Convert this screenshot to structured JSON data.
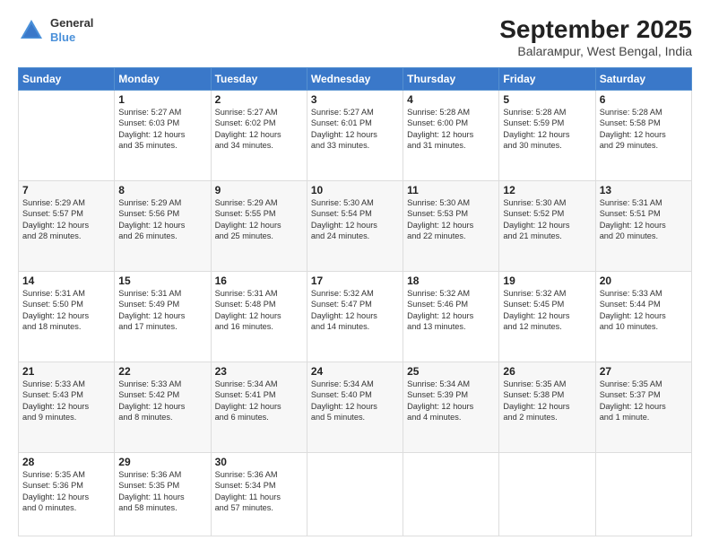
{
  "header": {
    "logo": {
      "line1": "General",
      "line2": "Blue"
    },
    "title": "September 2025",
    "subtitle": "Balarамpur, West Bengal, India"
  },
  "days_header": [
    "Sunday",
    "Monday",
    "Tuesday",
    "Wednesday",
    "Thursday",
    "Friday",
    "Saturday"
  ],
  "weeks": [
    [
      {
        "num": "",
        "lines": []
      },
      {
        "num": "1",
        "lines": [
          "Sunrise: 5:27 AM",
          "Sunset: 6:03 PM",
          "Daylight: 12 hours",
          "and 35 minutes."
        ]
      },
      {
        "num": "2",
        "lines": [
          "Sunrise: 5:27 AM",
          "Sunset: 6:02 PM",
          "Daylight: 12 hours",
          "and 34 minutes."
        ]
      },
      {
        "num": "3",
        "lines": [
          "Sunrise: 5:27 AM",
          "Sunset: 6:01 PM",
          "Daylight: 12 hours",
          "and 33 minutes."
        ]
      },
      {
        "num": "4",
        "lines": [
          "Sunrise: 5:28 AM",
          "Sunset: 6:00 PM",
          "Daylight: 12 hours",
          "and 31 minutes."
        ]
      },
      {
        "num": "5",
        "lines": [
          "Sunrise: 5:28 AM",
          "Sunset: 5:59 PM",
          "Daylight: 12 hours",
          "and 30 minutes."
        ]
      },
      {
        "num": "6",
        "lines": [
          "Sunrise: 5:28 AM",
          "Sunset: 5:58 PM",
          "Daylight: 12 hours",
          "and 29 minutes."
        ]
      }
    ],
    [
      {
        "num": "7",
        "lines": [
          "Sunrise: 5:29 AM",
          "Sunset: 5:57 PM",
          "Daylight: 12 hours",
          "and 28 minutes."
        ]
      },
      {
        "num": "8",
        "lines": [
          "Sunrise: 5:29 AM",
          "Sunset: 5:56 PM",
          "Daylight: 12 hours",
          "and 26 minutes."
        ]
      },
      {
        "num": "9",
        "lines": [
          "Sunrise: 5:29 AM",
          "Sunset: 5:55 PM",
          "Daylight: 12 hours",
          "and 25 minutes."
        ]
      },
      {
        "num": "10",
        "lines": [
          "Sunrise: 5:30 AM",
          "Sunset: 5:54 PM",
          "Daylight: 12 hours",
          "and 24 minutes."
        ]
      },
      {
        "num": "11",
        "lines": [
          "Sunrise: 5:30 AM",
          "Sunset: 5:53 PM",
          "Daylight: 12 hours",
          "and 22 minutes."
        ]
      },
      {
        "num": "12",
        "lines": [
          "Sunrise: 5:30 AM",
          "Sunset: 5:52 PM",
          "Daylight: 12 hours",
          "and 21 minutes."
        ]
      },
      {
        "num": "13",
        "lines": [
          "Sunrise: 5:31 AM",
          "Sunset: 5:51 PM",
          "Daylight: 12 hours",
          "and 20 minutes."
        ]
      }
    ],
    [
      {
        "num": "14",
        "lines": [
          "Sunrise: 5:31 AM",
          "Sunset: 5:50 PM",
          "Daylight: 12 hours",
          "and 18 minutes."
        ]
      },
      {
        "num": "15",
        "lines": [
          "Sunrise: 5:31 AM",
          "Sunset: 5:49 PM",
          "Daylight: 12 hours",
          "and 17 minutes."
        ]
      },
      {
        "num": "16",
        "lines": [
          "Sunrise: 5:31 AM",
          "Sunset: 5:48 PM",
          "Daylight: 12 hours",
          "and 16 minutes."
        ]
      },
      {
        "num": "17",
        "lines": [
          "Sunrise: 5:32 AM",
          "Sunset: 5:47 PM",
          "Daylight: 12 hours",
          "and 14 minutes."
        ]
      },
      {
        "num": "18",
        "lines": [
          "Sunrise: 5:32 AM",
          "Sunset: 5:46 PM",
          "Daylight: 12 hours",
          "and 13 minutes."
        ]
      },
      {
        "num": "19",
        "lines": [
          "Sunrise: 5:32 AM",
          "Sunset: 5:45 PM",
          "Daylight: 12 hours",
          "and 12 minutes."
        ]
      },
      {
        "num": "20",
        "lines": [
          "Sunrise: 5:33 AM",
          "Sunset: 5:44 PM",
          "Daylight: 12 hours",
          "and 10 minutes."
        ]
      }
    ],
    [
      {
        "num": "21",
        "lines": [
          "Sunrise: 5:33 AM",
          "Sunset: 5:43 PM",
          "Daylight: 12 hours",
          "and 9 minutes."
        ]
      },
      {
        "num": "22",
        "lines": [
          "Sunrise: 5:33 AM",
          "Sunset: 5:42 PM",
          "Daylight: 12 hours",
          "and 8 minutes."
        ]
      },
      {
        "num": "23",
        "lines": [
          "Sunrise: 5:34 AM",
          "Sunset: 5:41 PM",
          "Daylight: 12 hours",
          "and 6 minutes."
        ]
      },
      {
        "num": "24",
        "lines": [
          "Sunrise: 5:34 AM",
          "Sunset: 5:40 PM",
          "Daylight: 12 hours",
          "and 5 minutes."
        ]
      },
      {
        "num": "25",
        "lines": [
          "Sunrise: 5:34 AM",
          "Sunset: 5:39 PM",
          "Daylight: 12 hours",
          "and 4 minutes."
        ]
      },
      {
        "num": "26",
        "lines": [
          "Sunrise: 5:35 AM",
          "Sunset: 5:38 PM",
          "Daylight: 12 hours",
          "and 2 minutes."
        ]
      },
      {
        "num": "27",
        "lines": [
          "Sunrise: 5:35 AM",
          "Sunset: 5:37 PM",
          "Daylight: 12 hours",
          "and 1 minute."
        ]
      }
    ],
    [
      {
        "num": "28",
        "lines": [
          "Sunrise: 5:35 AM",
          "Sunset: 5:36 PM",
          "Daylight: 12 hours",
          "and 0 minutes."
        ]
      },
      {
        "num": "29",
        "lines": [
          "Sunrise: 5:36 AM",
          "Sunset: 5:35 PM",
          "Daylight: 11 hours",
          "and 58 minutes."
        ]
      },
      {
        "num": "30",
        "lines": [
          "Sunrise: 5:36 AM",
          "Sunset: 5:34 PM",
          "Daylight: 11 hours",
          "and 57 minutes."
        ]
      },
      {
        "num": "",
        "lines": []
      },
      {
        "num": "",
        "lines": []
      },
      {
        "num": "",
        "lines": []
      },
      {
        "num": "",
        "lines": []
      }
    ]
  ]
}
